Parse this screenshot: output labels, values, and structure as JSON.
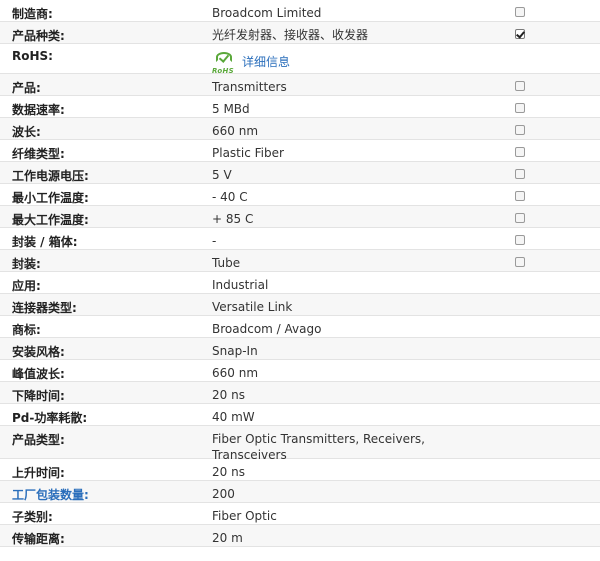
{
  "specs": [
    {
      "label": "制造商:",
      "value": "Broadcom Limited",
      "checkbox": "unchecked"
    },
    {
      "label": "产品种类:",
      "value": "光纤发射器、接收器、收发器",
      "checkbox": "checked"
    },
    {
      "label": "RoHS:",
      "rohs_logo": "RoHS",
      "link": "详细信息",
      "checkbox": "none"
    },
    {
      "label": "产品:",
      "value": "Transmitters",
      "checkbox": "unchecked"
    },
    {
      "label": "数据速率:",
      "value": "5 MBd",
      "checkbox": "unchecked"
    },
    {
      "label": "波长:",
      "value": "660 nm",
      "checkbox": "unchecked"
    },
    {
      "label": "纤维类型:",
      "value": "Plastic Fiber",
      "checkbox": "unchecked"
    },
    {
      "label": "工作电源电压:",
      "value": "5 V",
      "checkbox": "unchecked"
    },
    {
      "label": "最小工作温度:",
      "value": "- 40 C",
      "checkbox": "unchecked"
    },
    {
      "label": "最大工作温度:",
      "value": "+ 85 C",
      "checkbox": "unchecked"
    },
    {
      "label": "封装 / 箱体:",
      "value": "-",
      "checkbox": "unchecked"
    },
    {
      "label": "封装:",
      "value": "Tube",
      "checkbox": "unchecked"
    },
    {
      "label": "应用:",
      "value": "Industrial",
      "checkbox": "none"
    },
    {
      "label": "连接器类型:",
      "value": "Versatile Link",
      "checkbox": "none"
    },
    {
      "label": "商标:",
      "value": "Broadcom / Avago",
      "checkbox": "none"
    },
    {
      "label": "安装风格:",
      "value": "Snap-In",
      "checkbox": "none"
    },
    {
      "label": "峰值波长:",
      "value": "660 nm",
      "checkbox": "none"
    },
    {
      "label": "下降时间:",
      "value": "20 ns",
      "checkbox": "none"
    },
    {
      "label": "Pd-功率耗散:",
      "value": "40 mW",
      "checkbox": "none"
    },
    {
      "label": "产品类型:",
      "value": "Fiber Optic Transmitters, Receivers, Transceivers",
      "checkbox": "none"
    },
    {
      "label": "上升时间:",
      "value": "20 ns",
      "checkbox": "none"
    },
    {
      "label": "工厂包装数量:",
      "value": "200",
      "checkbox": "none",
      "label_is_link": true
    },
    {
      "label": "子类别:",
      "value": "Fiber Optic",
      "checkbox": "none"
    },
    {
      "label": "传输距离:",
      "value": "20 m",
      "checkbox": "none"
    }
  ],
  "colors": {
    "zebra": "#f7f7f7",
    "border": "#e3e3e3",
    "link": "#2a6ebb",
    "rohs_green": "#5aa83a"
  }
}
